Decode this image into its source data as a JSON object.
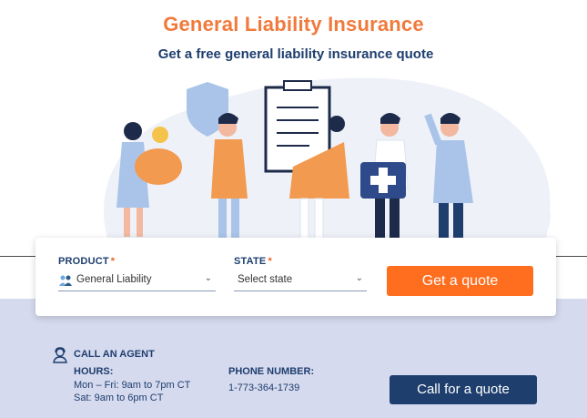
{
  "header": {
    "title": "General Liability Insurance",
    "subtitle": "Get a free general liability insurance quote"
  },
  "hero": {
    "illustration": "people-with-insurance-items-illustration"
  },
  "form": {
    "product_label": "PRODUCT",
    "product_required": "*",
    "product_value": "General Liability",
    "product_icon": "people-icon",
    "state_label": "STATE",
    "state_required": "*",
    "state_value": "Select state",
    "quote_button": "Get a quote"
  },
  "agent": {
    "icon": "agent-icon",
    "heading": "CALL AN AGENT",
    "hours_label": "HOURS:",
    "hours_weekday": "Mon – Fri: 9am to 7pm CT",
    "hours_saturday": "Sat: 9am to 6pm CT",
    "phone_label": "PHONE NUMBER:",
    "phone_value": "1-773-364-1739",
    "call_button": "Call for a quote"
  },
  "colors": {
    "accent": "#FF6D1E",
    "title": "#F07A3B",
    "navy": "#1E3E6E",
    "band": "#D6DAEE"
  }
}
